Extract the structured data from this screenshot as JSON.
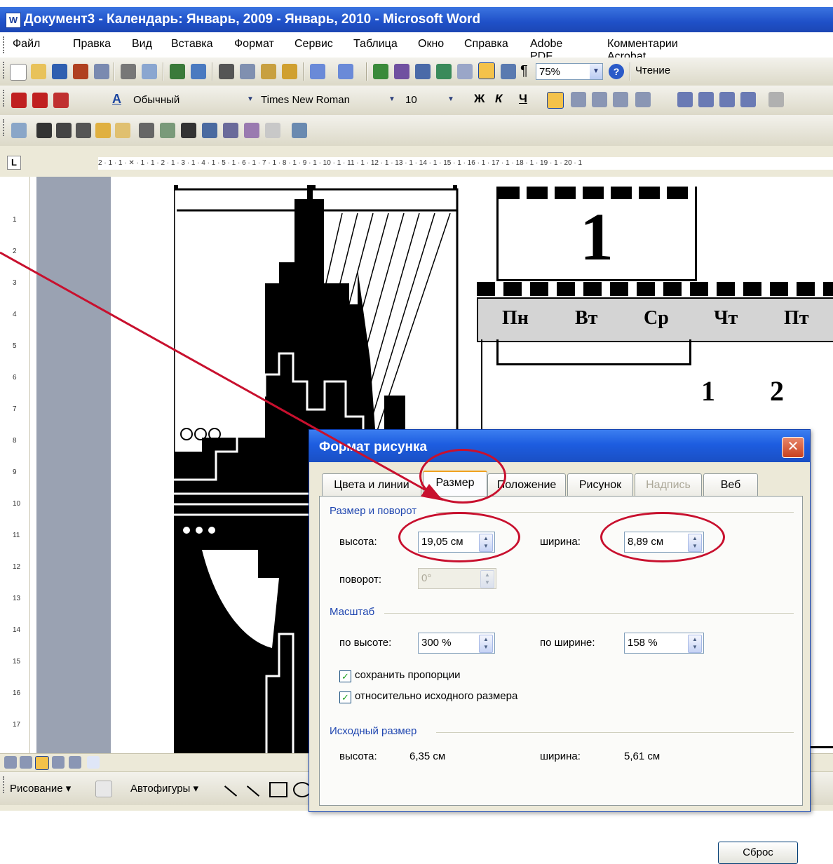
{
  "window": {
    "title": "Документ3 - Календарь: Январь, 2009 - Январь, 2010 - Microsoft Word"
  },
  "menu": [
    "Файл",
    "Правка",
    "Вид",
    "Вставка",
    "Формат",
    "Сервис",
    "Таблица",
    "Окно",
    "Справка",
    "Adobe PDF",
    "Комментарии Acrobat"
  ],
  "toolbar": {
    "zoom": "75%",
    "read_label": "Чтение",
    "style": "Обычный",
    "style_icon_text": "A",
    "font": "Times New Roman",
    "font_size": "10",
    "bold_glyph": "Ж",
    "italic_glyph": "К",
    "underline_glyph": "Ч",
    "pilcrow": "¶"
  },
  "ruler": {
    "tab_selector": "L",
    "marks": "2 · 1 · 1 · ✕ · 1 · 1 · 2 · 1 · 3 · 1 · 4 · 1 · 5 · 1 · 6 · 1 · 7 · 1 · 8 · 1 · 9 · 1 · 10 · 1 · 11 · 1 · 12 · 1 · 13 · 1 · 14 · 1 · 15 · 1 · 16 · 1 · 17 · 1 · 18 · 1 · 19 · 1 · 20 · 1",
    "vertical": [
      "1",
      "2",
      "3",
      "4",
      "5",
      "6",
      "7",
      "8",
      "9",
      "10",
      "11",
      "12",
      "13",
      "14",
      "15",
      "16",
      "17"
    ]
  },
  "calendar": {
    "month_number": "1",
    "weekdays": [
      "Пн",
      "Вт",
      "Ср",
      "Чт",
      "Пт"
    ],
    "days": [
      "1",
      "2"
    ]
  },
  "dialog": {
    "title": "Формат рисунка",
    "close_glyph": "✕",
    "tabs": [
      {
        "label": "Цвета и линии",
        "active": false,
        "enabled": true
      },
      {
        "label": "Размер",
        "active": true,
        "enabled": true
      },
      {
        "label": "Положение",
        "active": false,
        "enabled": true
      },
      {
        "label": "Рисунок",
        "active": false,
        "enabled": true
      },
      {
        "label": "Надпись",
        "active": false,
        "enabled": false
      },
      {
        "label": "Веб",
        "active": false,
        "enabled": true
      }
    ],
    "size_rotate": {
      "group_label": "Размер и поворот",
      "height_label": "высота:",
      "height_value": "19,05 см",
      "width_label": "ширина:",
      "width_value": "8,89 см",
      "rotation_label": "поворот:",
      "rotation_value": "0°"
    },
    "scale": {
      "group_label": "Масштаб",
      "height_label": "по высоте:",
      "height_value": "300 %",
      "width_label": "по ширине:",
      "width_value": "158 %",
      "lock_aspect_label": "сохранить пропорции",
      "lock_aspect": true,
      "relative_label": "относительно исходного размера",
      "relative": true
    },
    "original": {
      "group_label": "Исходный размер",
      "height_label": "высота:",
      "height_value": "6,35 см",
      "width_label": "ширина:",
      "width_value": "5,61 см",
      "reset_label": "Сброс"
    }
  },
  "drawing": {
    "draw_label": "Рисование ▾",
    "autoshapes_label": "Автофигуры ▾"
  },
  "annotation_color": "#c8102e"
}
